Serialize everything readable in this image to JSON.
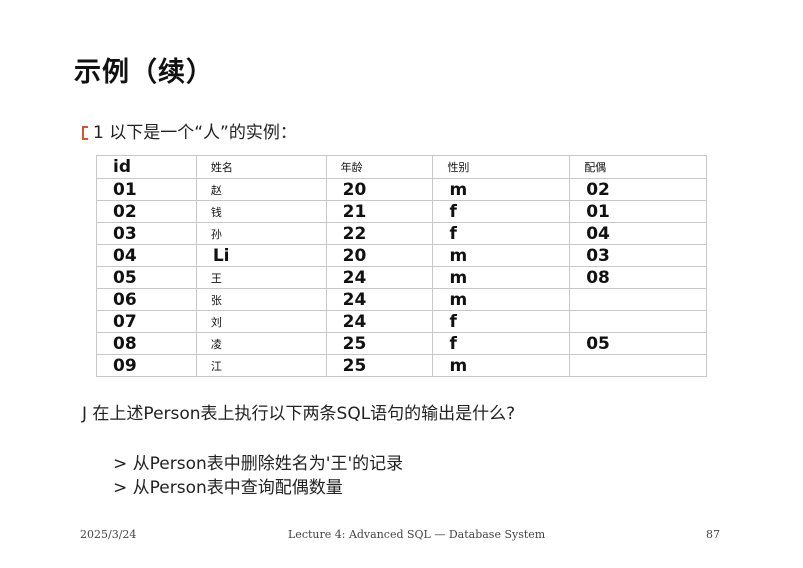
{
  "title": "示例（续）",
  "intro": {
    "text": "1 以下是一个“人”的实例："
  },
  "table": {
    "headers": [
      "id",
      "姓名",
      "年龄",
      "性别",
      "配偶"
    ],
    "rows": [
      [
        "01",
        "赵",
        "20",
        "m",
        "02"
      ],
      [
        "02",
        "钱",
        "21",
        "f",
        "01"
      ],
      [
        "03",
        "孙",
        "22",
        "f",
        "04"
      ],
      [
        "04",
        "Li",
        "20",
        "m",
        "03"
      ],
      [
        "05",
        "王",
        "24",
        "m",
        "08"
      ],
      [
        "06",
        "张",
        "24",
        "m",
        ""
      ],
      [
        "07",
        "刘",
        "24",
        "f",
        ""
      ],
      [
        "08",
        "凌",
        "25",
        "f",
        "05"
      ],
      [
        "09",
        "江",
        "25",
        "m",
        ""
      ]
    ]
  },
  "question": {
    "text": "J 在上述Person表上执行以下两条SQL语句的输出是什么?"
  },
  "items": [
    "> 从Person表中删除姓名为'王'的记录",
    "> 从Person表中查询配偶数量"
  ],
  "footer": {
    "date": "2025/3/24",
    "course": "Lecture 4: Advanced SQL — Database System",
    "page": "87"
  }
}
